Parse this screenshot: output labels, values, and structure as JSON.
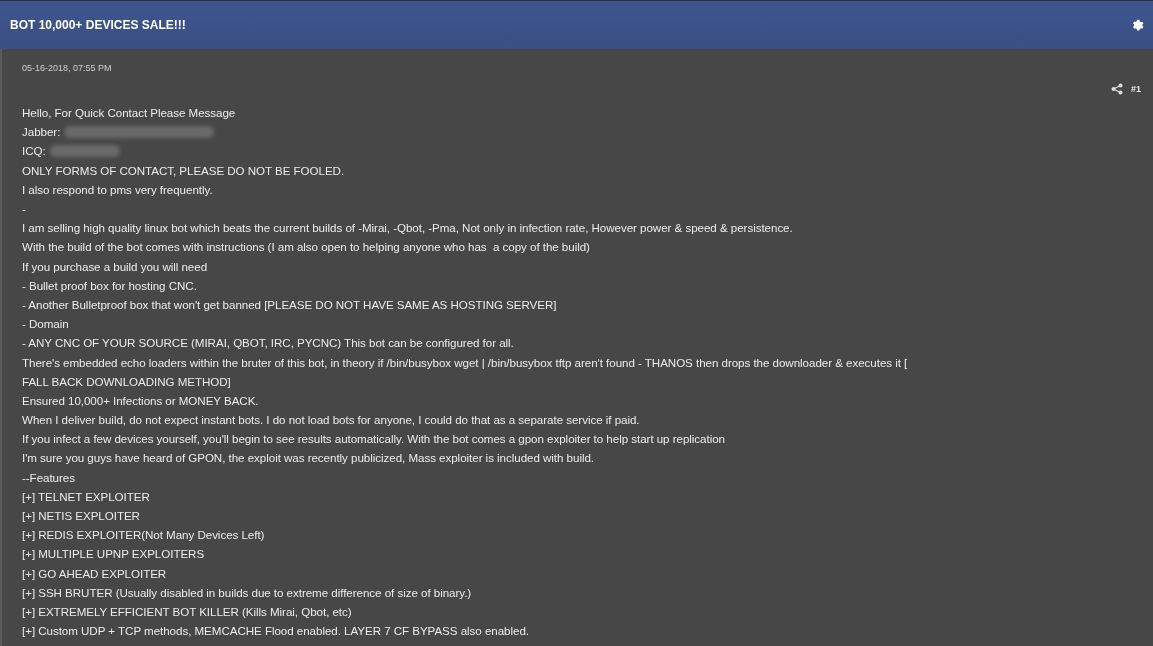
{
  "header": {
    "title": "BOT 10,000+ DEVICES SALE!!!"
  },
  "post": {
    "date": "05-16-2018, 07:55 PM",
    "number": "#1",
    "lines": [
      {
        "text": "Hello, For Quick Contact Please Message",
        "redacted": false
      },
      {
        "text": "Jabber:",
        "redacted": true
      },
      {
        "text": "ICQ:",
        "redacted": true
      },
      {
        "text": "ONLY FORMS OF CONTACT, PLEASE DO NOT BE FOOLED.",
        "redacted": false
      },
      {
        "text": "I also respond to pms very frequently.",
        "redacted": false
      },
      {
        "text": "-",
        "redacted": false
      },
      {
        "text": "I am selling high quality linux bot which beats the current builds of -Mirai, -Qbot, -Pma, Not only in infection rate, However power & speed & persistence.",
        "redacted": false
      },
      {
        "text": "With the build of the bot comes with instructions (I am also open to helping anyone who has  a copy of the build)",
        "redacted": false
      },
      {
        "text": "If you purchase a build you will need",
        "redacted": false
      },
      {
        "text": "- Bullet proof box for hosting CNC.",
        "redacted": false
      },
      {
        "text": "- Another Bulletproof box that won't get banned [PLEASE DO NOT HAVE SAME AS HOSTING SERVER]",
        "redacted": false
      },
      {
        "text": "- Domain",
        "redacted": false
      },
      {
        "text": "- ANY CNC OF YOUR SOURCE (MIRAI, QBOT, IRC, PYCNC) This bot can be configured for all.",
        "redacted": false
      },
      {
        "text": "There's embedded echo loaders within the bruter of this bot, in theory if /bin/busybox wget | /bin/busybox tftp aren't found - THANOS then drops the downloader & executes it [",
        "redacted": false
      },
      {
        "text": "FALL BACK DOWNLOADING METHOD]",
        "redacted": false
      },
      {
        "text": "Ensured 10,000+ Infections or MONEY BACK.",
        "redacted": false
      },
      {
        "text": "When I deliver build, do not expect instant bots. I do not load bots for anyone, I could do that as a separate service if paid.",
        "redacted": false
      },
      {
        "text": "If you infect a few devices yourself, you'll begin to see results automatically. With the bot comes a gpon exploiter to help start up replication",
        "redacted": false
      },
      {
        "text": "I'm sure you guys have heard of GPON, the exploit was recently publicized, Mass exploiter is included with build.",
        "redacted": false
      },
      {
        "text": "--Features",
        "redacted": false
      },
      {
        "text": "[+] TELNET EXPLOITER",
        "redacted": false
      },
      {
        "text": "[+] NETIS EXPLOITER",
        "redacted": false
      },
      {
        "text": "[+] REDIS EXPLOITER(Not Many Devices Left)",
        "redacted": false
      },
      {
        "text": "[+] MULTIPLE UPNP EXPLOITERS",
        "redacted": false
      },
      {
        "text": "[+] GO AHEAD EXPLOITER",
        "redacted": false
      },
      {
        "text": "[+] SSH BRUTER (Usually disabled in builds due to extreme difference of size of binary.)",
        "redacted": false
      },
      {
        "text": "[+] EXTREMELY EFFICIENT BOT KILLER (Kills Mirai, Qbot, etc)",
        "redacted": false
      },
      {
        "text": "[+] Custom UDP + TCP methods, MEMCACHE Flood enabled. LAYER 7 CF BYPASS also enabled.",
        "redacted": false
      }
    ]
  }
}
